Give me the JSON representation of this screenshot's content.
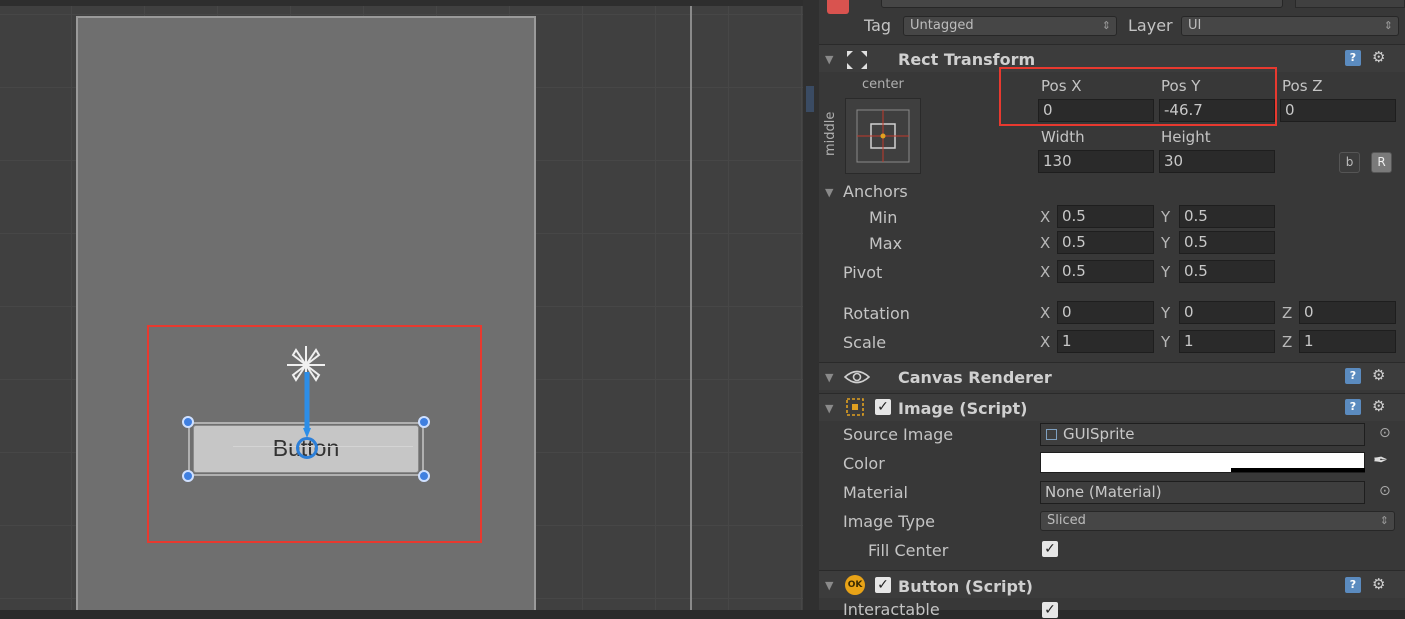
{
  "scene": {
    "button_text": "Button"
  },
  "inspector": {
    "header": {
      "tag_label": "Tag",
      "tag_value": "Untagged",
      "layer_label": "Layer",
      "layer_value": "UI"
    },
    "rect_transform": {
      "title": "Rect Transform",
      "anchor_preset_h": "center",
      "anchor_preset_v": "middle",
      "pos_x_label": "Pos X",
      "pos_y_label": "Pos Y",
      "pos_z_label": "Pos Z",
      "pos_x": "0",
      "pos_y": "-46.7",
      "pos_z": "0",
      "width_label": "Width",
      "height_label": "Height",
      "width": "130",
      "height": "30",
      "b_button": "b",
      "r_button": "R",
      "anchors_label": "Anchors",
      "min_label": "Min",
      "max_label": "Max",
      "pivot_label": "Pivot",
      "rotation_label": "Rotation",
      "scale_label": "Scale",
      "axis_x": "X",
      "axis_y": "Y",
      "axis_z": "Z",
      "anchor_min_x": "0.5",
      "anchor_min_y": "0.5",
      "anchor_max_x": "0.5",
      "anchor_max_y": "0.5",
      "pivot_x": "0.5",
      "pivot_y": "0.5",
      "rotation_x": "0",
      "rotation_y": "0",
      "rotation_z": "0",
      "scale_x": "1",
      "scale_y": "1",
      "scale_z": "1"
    },
    "canvas_renderer": {
      "title": "Canvas Renderer"
    },
    "image_script": {
      "title": "Image (Script)",
      "source_image_label": "Source Image",
      "source_image_value": "GUISprite",
      "color_label": "Color",
      "material_label": "Material",
      "material_value": "None (Material)",
      "image_type_label": "Image Type",
      "image_type_value": "Sliced",
      "fill_center_label": "Fill Center"
    },
    "button_script": {
      "title": "Button (Script)",
      "interactable_label": "Interactable"
    }
  },
  "colors": {
    "highlight_red": "#e8392f",
    "handle_blue": "#3f7fe0",
    "help_blue": "#5b8bbf"
  }
}
